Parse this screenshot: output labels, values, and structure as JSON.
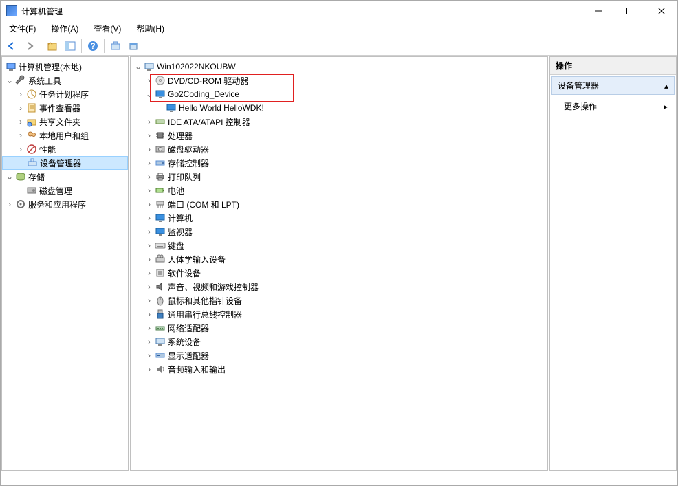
{
  "window": {
    "title": "计算机管理"
  },
  "menu": {
    "file": "文件(F)",
    "action": "操作(A)",
    "view": "查看(V)",
    "help": "帮助(H)"
  },
  "leftTree": {
    "root": "计算机管理(本地)",
    "sysTools": "系统工具",
    "taskScheduler": "任务计划程序",
    "eventViewer": "事件查看器",
    "sharedFolders": "共享文件夹",
    "localUsers": "本地用户和组",
    "performance": "性能",
    "deviceManager": "设备管理器",
    "storage": "存储",
    "diskManagement": "磁盘管理",
    "servicesApps": "服务和应用程序"
  },
  "centerTree": {
    "root": "Win102022NKOUBW",
    "dvd": "DVD/CD-ROM 驱动器",
    "go2coding": "Go2Coding_Device",
    "helloworld": "Hello World HelloWDK!",
    "ide": "IDE ATA/ATAPI 控制器",
    "cpu": "处理器",
    "diskdrive": "磁盘驱动器",
    "storagectrl": "存储控制器",
    "printqueue": "打印队列",
    "battery": "电池",
    "ports": "端口 (COM 和 LPT)",
    "computer": "计算机",
    "monitor": "监视器",
    "keyboard": "键盘",
    "hid": "人体学输入设备",
    "software": "软件设备",
    "sound": "声音、视频和游戏控制器",
    "mouse": "鼠标和其他指针设备",
    "usb": "通用串行总线控制器",
    "network": "网络适配器",
    "system": "系统设备",
    "display": "显示适配器",
    "audio": "音频输入和输出"
  },
  "rightPanel": {
    "header": "操作",
    "section": "设备管理器",
    "moreActions": "更多操作"
  }
}
